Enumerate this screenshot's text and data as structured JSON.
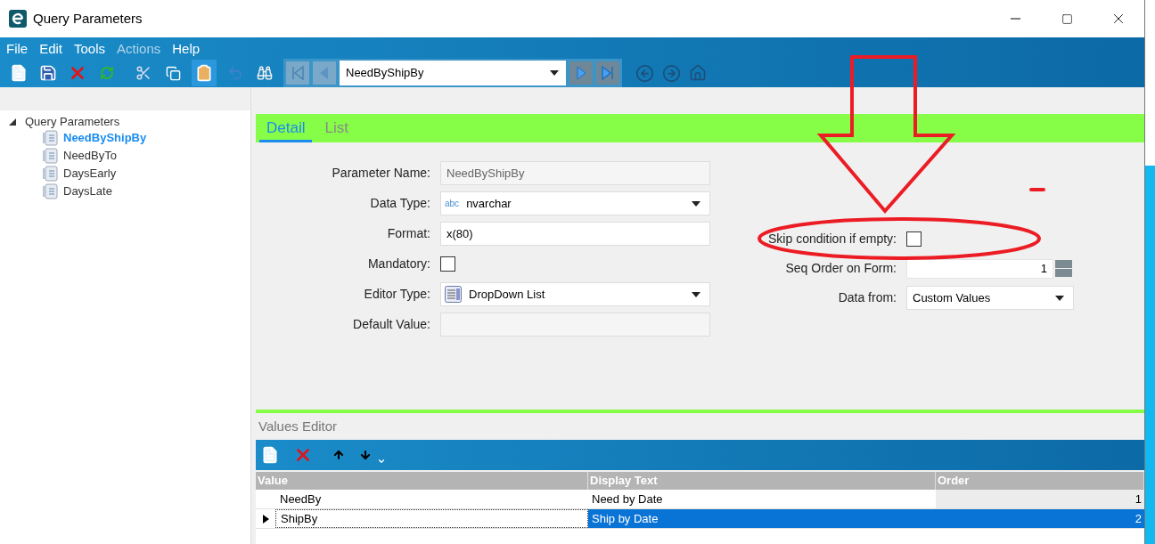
{
  "window": {
    "title": "Query Parameters"
  },
  "menu": [
    {
      "label": "File",
      "disabled": false
    },
    {
      "label": "Edit",
      "disabled": false
    },
    {
      "label": "Tools",
      "disabled": false
    },
    {
      "label": "Actions",
      "disabled": true
    },
    {
      "label": "Help",
      "disabled": false
    }
  ],
  "record_selector": {
    "value": "NeedByShipBy"
  },
  "tree": {
    "label": "Query Parameters",
    "expanded": true,
    "children": [
      {
        "label": "NeedByShipBy",
        "selected": true
      },
      {
        "label": "NeedByTo",
        "selected": false
      },
      {
        "label": "DaysEarly",
        "selected": false
      },
      {
        "label": "DaysLate",
        "selected": false
      }
    ]
  },
  "tabs": [
    {
      "label": "Detail",
      "selected": true
    },
    {
      "label": "List",
      "selected": false
    }
  ],
  "form_left": [
    {
      "kind": "readonly",
      "label": "Parameter Name:",
      "value": "NeedByShipBy"
    },
    {
      "kind": "dropdown",
      "label": "Data Type:",
      "value": "nvarchar",
      "prefix": "abc"
    },
    {
      "kind": "text",
      "label": "Format:",
      "value": "x(80)"
    },
    {
      "kind": "checkbox",
      "label": "Mandatory:",
      "checked": false
    },
    {
      "kind": "dropdown",
      "label": "Editor Type:",
      "value": "DropDown List",
      "icon": true
    },
    {
      "kind": "readonly",
      "label": "Default Value:"
    }
  ],
  "form_right": [
    {
      "kind": "checkbox",
      "label": "Skip condition if empty:",
      "checked": false
    },
    {
      "kind": "spinner",
      "label": "Seq Order on Form:",
      "value": "1"
    },
    {
      "kind": "dropdown",
      "label": "Data from:",
      "value": "Custom Values"
    }
  ],
  "values_editor": {
    "title": "Values Editor",
    "columns": [
      "Value",
      "Display Text",
      "Order"
    ],
    "rows": [
      {
        "value": "NeedBy",
        "display_text": "Need by Date",
        "order": "1",
        "selected": false
      },
      {
        "value": "ShipBy",
        "display_text": "Ship by Date",
        "order": "2",
        "selected": true
      }
    ]
  }
}
